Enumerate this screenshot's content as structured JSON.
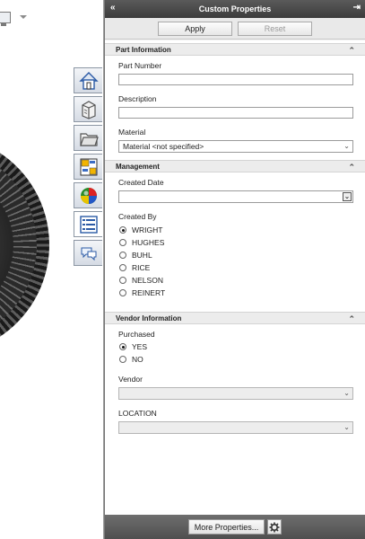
{
  "pane": {
    "title": "Custom Properties",
    "apply_label": "Apply",
    "reset_label": "Reset",
    "more_properties_label": "More Properties..."
  },
  "tabs": [
    {
      "icon": "home-icon"
    },
    {
      "icon": "design-library-icon"
    },
    {
      "icon": "file-explorer-icon"
    },
    {
      "icon": "view-palette-icon"
    },
    {
      "icon": "appearances-icon"
    },
    {
      "icon": "custom-properties-icon"
    },
    {
      "icon": "forum-icon"
    }
  ],
  "part_information": {
    "header": "Part Information",
    "part_number_label": "Part Number",
    "part_number_value": "",
    "description_label": "Description",
    "description_value": "",
    "material_label": "Material",
    "material_value": "Material <not specified>"
  },
  "management": {
    "header": "Management",
    "created_date_label": "Created Date",
    "created_date_value": "",
    "created_by_label": "Created By",
    "created_by_options": [
      "WRIGHT",
      "HUGHES",
      "BUHL",
      "RICE",
      "NELSON",
      "REINERT"
    ],
    "created_by_selected": "WRIGHT"
  },
  "vendor_information": {
    "header": "Vendor Information",
    "purchased_label": "Purchased",
    "purchased_options": [
      "YES",
      "NO"
    ],
    "purchased_selected": "YES",
    "vendor_label": "Vendor",
    "vendor_value": "",
    "location_label": "LOCATION",
    "location_value": ""
  },
  "icons": {
    "collapse": "«",
    "pin": "⇥",
    "chevron_up": "⌃",
    "dropdown": "⌄"
  }
}
